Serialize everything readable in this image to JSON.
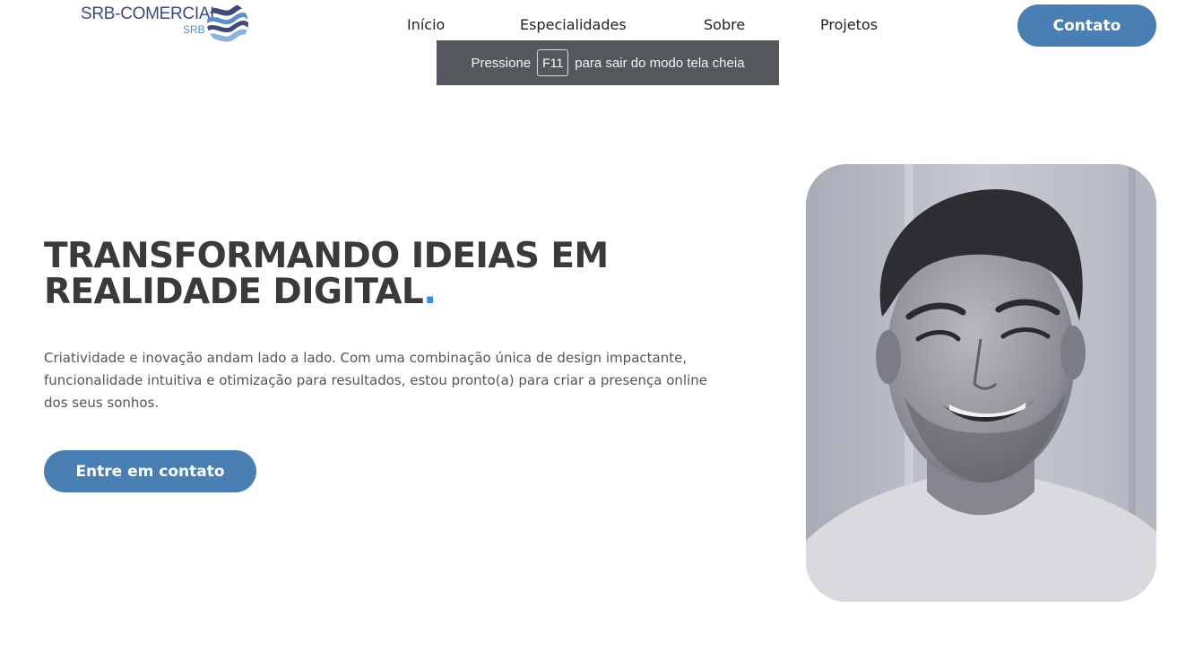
{
  "header": {
    "logo_text": "SRB-COMERCIAL",
    "logo_sub": "SRB",
    "nav": [
      {
        "label": "Início"
      },
      {
        "label": "Especialidades"
      },
      {
        "label": "Sobre"
      },
      {
        "label": "Projetos"
      }
    ],
    "cta_label": "Contato"
  },
  "fullscreen_toast": {
    "before": "Pressione",
    "key": "F11",
    "after": "para sair do modo tela cheia"
  },
  "hero": {
    "title_line1": "TRANSFORMANDO IDEIAS EM",
    "title_line2": "REALIDADE DIGITAL",
    "title_dot": ".",
    "description": "Criatividade e inovação andam lado a lado. Com uma combinação única de design impactante, funcionalidade intuitiva e otimização para resultados, estou pronto(a) para criar a presença online dos seus sonhos.",
    "cta_label": "Entre em contato",
    "portrait_icon": "person-portrait-photo"
  },
  "colors": {
    "accent": "#4a7fb4",
    "title_dot": "#3b8ae6",
    "toast_bg": "#54585c",
    "logo_dark": "#3f4a78",
    "logo_light": "#5b8fc3"
  }
}
